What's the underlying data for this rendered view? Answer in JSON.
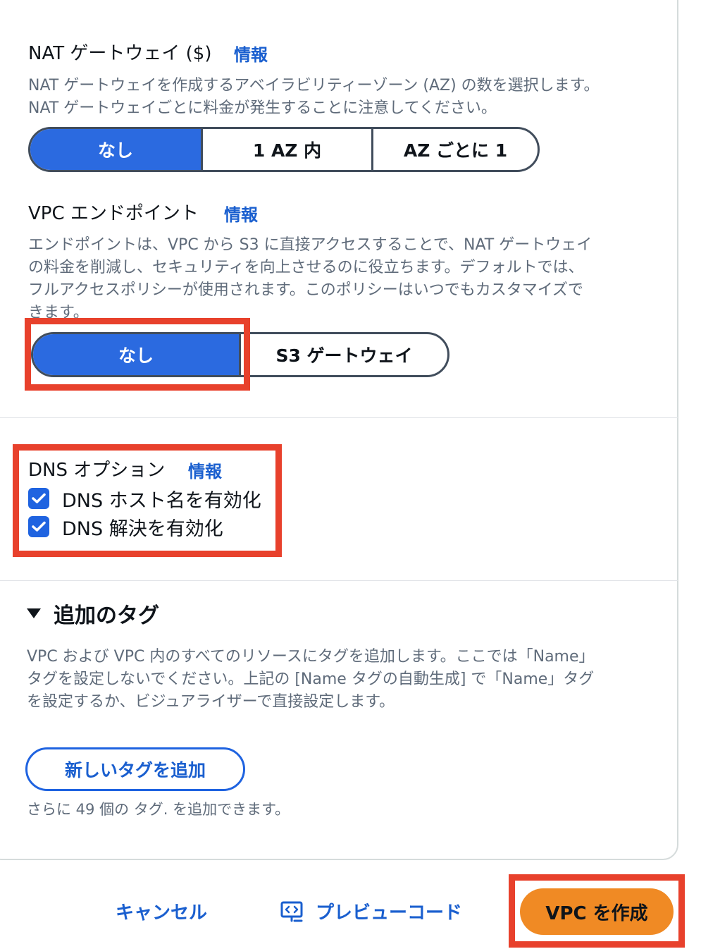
{
  "nat": {
    "label": "NAT ゲートウェイ ($)",
    "info": "情報",
    "desc_lines": [
      "NAT ゲートウェイを作成するアベイラビリティーゾーン (AZ) の数を選択します。",
      "NAT ゲートウェイごとに料金が発生することに注意してください。"
    ],
    "options": [
      "なし",
      "1 AZ 内",
      "AZ ごとに 1"
    ],
    "selected": "なし"
  },
  "endpoint": {
    "label": "VPC エンドポイント",
    "info": "情報",
    "desc_lines": [
      "エンドポイントは、VPC から S3 に直接アクセスすることで、NAT ゲートウェイ",
      "の料金を削減し、セキュリティを向上させるのに役立ちます。デフォルトでは、",
      "フルアクセスポリシーが使用されます。このポリシーはいつでもカスタマイズで",
      "きます。"
    ],
    "options": [
      "なし",
      "S3 ゲートウェイ"
    ],
    "selected": "なし"
  },
  "dns": {
    "label": "DNS オプション",
    "info": "情報",
    "hostnames_label": "DNS ホスト名を有効化",
    "hostnames_checked": true,
    "resolution_label": "DNS 解決を有効化",
    "resolution_checked": true
  },
  "tags": {
    "title": "追加のタグ",
    "desc_lines": [
      "VPC および VPC 内のすべてのリソースにタグを追加します。ここでは「Name」",
      "タグを設定しないでください。上記の [Name タグの自動生成] で「Name」タグ",
      "を設定するか、ビジュアライザーで直接設定します。"
    ],
    "add_button": "新しいタグを追加",
    "remaining": "さらに 49 個の タグ. を追加できます。"
  },
  "footer": {
    "cancel": "キャンセル",
    "preview": "プレビューコード",
    "create": "VPC を作成"
  },
  "colors": {
    "selected_segment": "#2b6ae0",
    "link": "#1a5fcf",
    "highlight": "#e8412c",
    "primary_button": "#f08a24"
  }
}
